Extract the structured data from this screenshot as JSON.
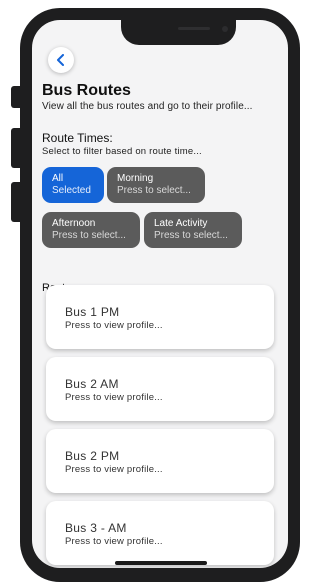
{
  "header": {
    "title": "Bus Routes",
    "subtitle": "View all the bus routes and go to their profile..."
  },
  "route_times": {
    "title": "Route Times:",
    "subtitle": "Select to filter based on route time...",
    "chips": [
      {
        "label": "All",
        "sub": "Selected",
        "selected": true
      },
      {
        "label": "Morning",
        "sub": "Press to select...",
        "selected": false
      },
      {
        "label": "Afternoon",
        "sub": "Press to select...",
        "selected": false
      },
      {
        "label": "Late Activity",
        "sub": "Press to select...",
        "selected": false
      }
    ]
  },
  "routes": {
    "label": "Routes:",
    "items": [
      {
        "name": "Bus 1 PM",
        "hint": "Press to view profile..."
      },
      {
        "name": "Bus 2 AM",
        "hint": "Press to view profile..."
      },
      {
        "name": "Bus 2 PM",
        "hint": "Press to view profile..."
      },
      {
        "name": "Bus 3 - AM",
        "hint": "Press to view profile..."
      }
    ]
  },
  "icons": {
    "back": "chevron-left-icon"
  },
  "colors": {
    "accent": "#1565d8",
    "chip_unselected": "#5b5b5b",
    "device": "#1e1e1f",
    "screen_bg": "#f4f4f5"
  }
}
